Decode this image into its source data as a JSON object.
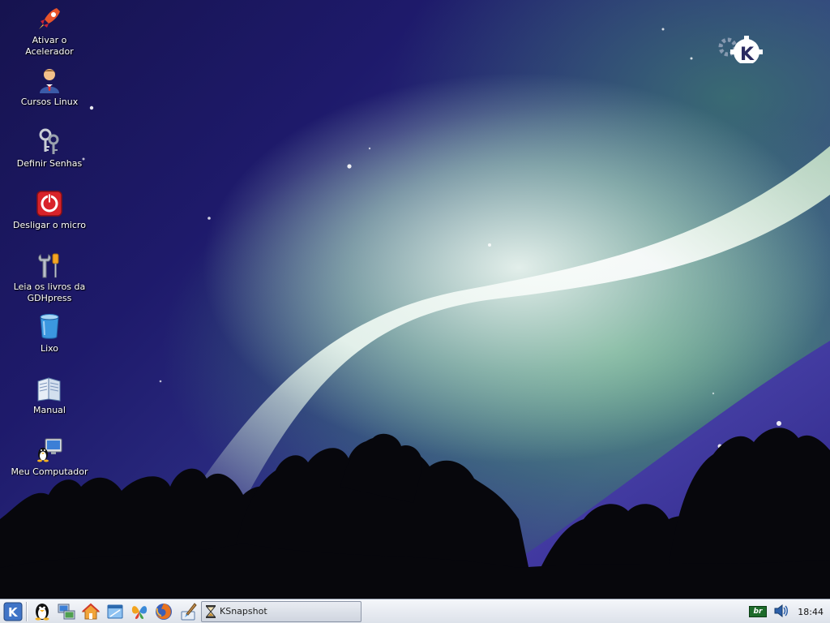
{
  "desktop": {
    "icons": [
      {
        "label": "Ativar o Acelerador",
        "icon": "rocket-icon"
      },
      {
        "label": "Cursos Linux",
        "icon": "user-tie-icon"
      },
      {
        "label": "Definir Senhas",
        "icon": "keys-icon"
      },
      {
        "label": "Desligar o micro",
        "icon": "power-icon"
      },
      {
        "label": "Leia os livros da GDHpress",
        "icon": "tools-icon"
      },
      {
        "label": "Lixo",
        "icon": "trash-icon"
      },
      {
        "label": "Manual",
        "icon": "book-icon"
      },
      {
        "label": "Meu Computador",
        "icon": "computer-icon"
      }
    ]
  },
  "taskbar": {
    "launchers": [
      "kde-menu-icon",
      "tux-icon",
      "network-icon",
      "home-icon",
      "window-icon",
      "butterfly-icon",
      "firefox-icon",
      "paint-icon"
    ],
    "tasks": [
      {
        "label": "KSnapshot",
        "icon": "hourglass-icon"
      }
    ],
    "tray": {
      "keyboard_layout": "br",
      "volume_icon": "speaker-icon",
      "clock": "18:44"
    }
  }
}
